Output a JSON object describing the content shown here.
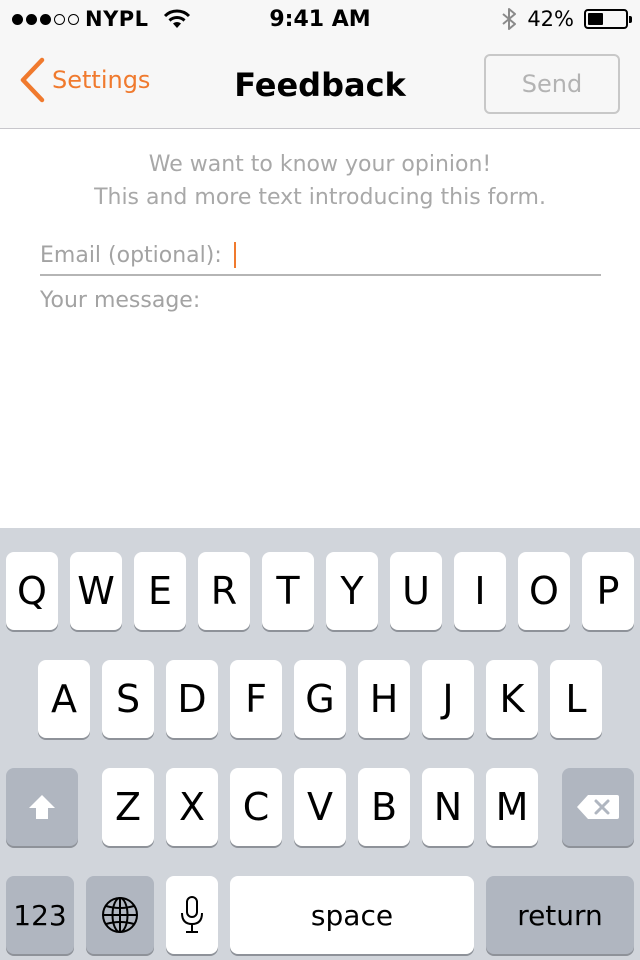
{
  "status_bar": {
    "signal_filled": 3,
    "signal_total": 5,
    "carrier": "NYPL",
    "wifi_icon": "wifi-icon",
    "time": "9:41 AM",
    "bluetooth_icon": "bluetooth-icon",
    "battery_percent": "42%",
    "battery_level": 0.42
  },
  "nav": {
    "back_label": "Settings",
    "title": "Feedback",
    "send_label": "Send"
  },
  "form": {
    "intro_line1": "We want to know your opinion!",
    "intro_line2": "This and more text introducing this form.",
    "email_label": "Email (optional):",
    "email_value": "",
    "message_label": "Your message:"
  },
  "keyboard": {
    "row1": [
      "Q",
      "W",
      "E",
      "R",
      "T",
      "Y",
      "U",
      "I",
      "O",
      "P"
    ],
    "row2": [
      "A",
      "S",
      "D",
      "F",
      "G",
      "H",
      "J",
      "K",
      "L"
    ],
    "row3": [
      "Z",
      "X",
      "C",
      "V",
      "B",
      "N",
      "M"
    ],
    "numbers_key": "123",
    "space_key": "space",
    "return_key": "return",
    "shift_icon": "shift-icon",
    "delete_icon": "delete-icon",
    "globe_icon": "globe-icon",
    "mic_icon": "microphone-icon"
  },
  "colors": {
    "accent": "#f07a2e",
    "keyboard_bg": "#d1d5db",
    "key_gray": "#b0b6c0",
    "placeholder_text": "#a3a3a3"
  }
}
